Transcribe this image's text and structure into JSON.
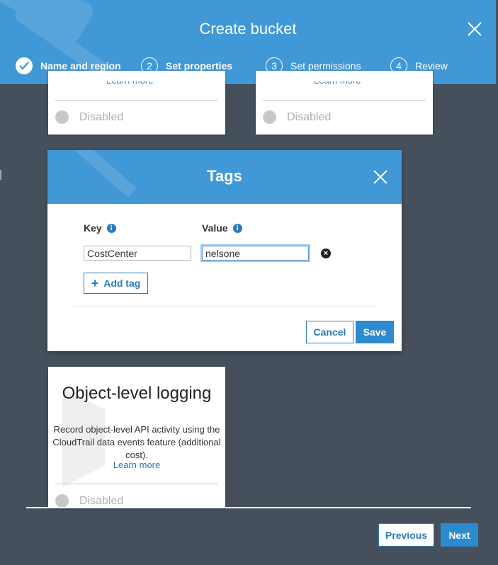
{
  "wizard": {
    "title": "Create bucket",
    "steps": [
      {
        "number": "",
        "label": "Name and region",
        "state": "done"
      },
      {
        "number": "2",
        "label": "Set properties",
        "state": "active"
      },
      {
        "number": "3",
        "label": "Set permissions",
        "state": "pending"
      },
      {
        "number": "4",
        "label": "Review",
        "state": "pending"
      }
    ]
  },
  "cards_top": [
    {
      "learn_more": "Learn more",
      "status": "Disabled"
    },
    {
      "learn_more": "Learn more",
      "status": "Disabled"
    }
  ],
  "tags_dialog": {
    "title": "Tags",
    "key_label": "Key",
    "value_label": "Value",
    "rows": [
      {
        "key": "CostCenter",
        "value": "nelsone"
      }
    ],
    "add_tag_label": "Add tag",
    "cancel_label": "Cancel",
    "save_label": "Save"
  },
  "object_logging": {
    "title": "Object-level logging",
    "description": "Record object-level API activity using the CloudTrail data events feature (additional cost).",
    "learn_more": "Learn more",
    "status": "Disabled"
  },
  "footer": {
    "previous_label": "Previous",
    "next_label": "Next"
  },
  "colors": {
    "header_blue": "#4198d6",
    "primary": "#2b8ad0",
    "link": "#2b7bb9",
    "backdrop": "#46505d"
  }
}
